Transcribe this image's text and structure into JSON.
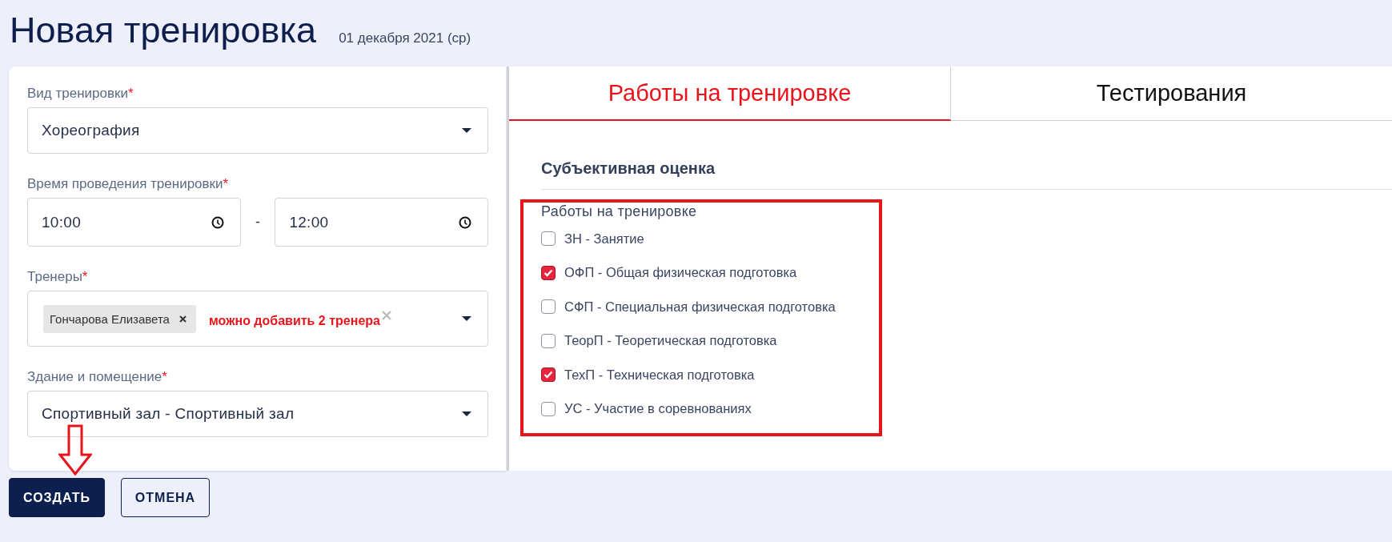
{
  "header": {
    "title": "Новая тренировка",
    "date": "01 декабря 2021 (ср)"
  },
  "form": {
    "fields": [
      {
        "kind": "select",
        "label": "Вид тренировки",
        "required_mark": "*",
        "value": "Хореография"
      },
      {
        "kind": "time_range",
        "label": "Время проведения тренировки",
        "required_mark": "*",
        "from": "10:00",
        "separator": "-",
        "to": "12:00"
      },
      {
        "kind": "multiselect",
        "label": "Тренеры",
        "required_mark": "*",
        "chips": [
          "Гончарова Елизавета"
        ],
        "note": "можно добавить 2 тренера"
      },
      {
        "kind": "select",
        "label": "Здание и помещение",
        "required_mark": "*",
        "value": "Спортивный зал - Спортивный зал"
      }
    ]
  },
  "tabs": [
    {
      "label": "Работы на тренировке",
      "selected": true
    },
    {
      "label": "Тестирования",
      "selected": false
    }
  ],
  "section": {
    "title": "Субъективная оценка",
    "group": {
      "label": "Работы на тренировке",
      "highlighted": true,
      "items": [
        {
          "label": "ЗН - Занятие",
          "checked": false
        },
        {
          "label": "ОФП - Общая физическая подготовка",
          "checked": true
        },
        {
          "label": "СФП - Специальная физическая подготовка",
          "checked": false
        },
        {
          "label": "ТеорП - Теоретическая подготовка",
          "checked": false
        },
        {
          "label": "ТехП - Техническая подготовка",
          "checked": true
        },
        {
          "label": "УС - Участие в соревнованиях",
          "checked": false
        }
      ]
    }
  },
  "buttons": [
    {
      "label": "СОЗДАТЬ",
      "kind": "primary",
      "pointed_at": true
    },
    {
      "label": "ОТМЕНА",
      "kind": "outline",
      "pointed_at": false
    }
  ]
}
